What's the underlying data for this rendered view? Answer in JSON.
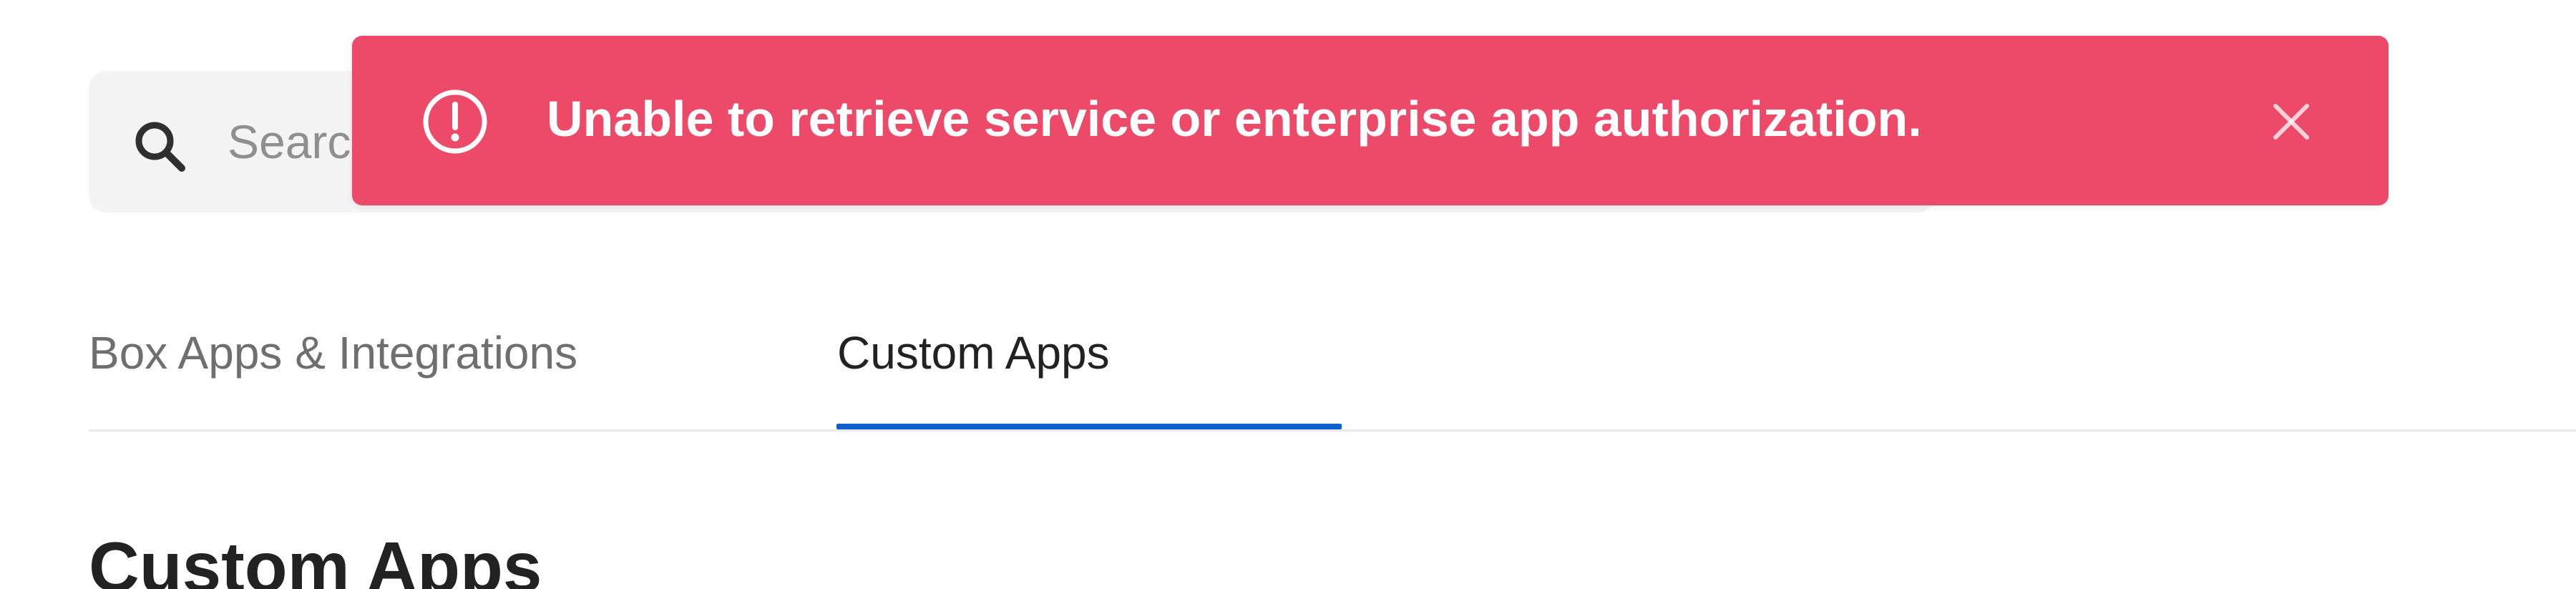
{
  "search": {
    "placeholder": "Search Users",
    "icon": "search-icon"
  },
  "toast": {
    "message": "Unable to retrieve service or enterprise app authorization.",
    "type": "error",
    "background_color": "#ed4a69",
    "icon": "alert-circle-icon",
    "close_icon": "close-icon"
  },
  "tabs": [
    {
      "label": "Box Apps & Integrations",
      "active": false
    },
    {
      "label": "Custom Apps",
      "active": true
    }
  ],
  "colors": {
    "accent": "#0f5fd1",
    "error": "#ed4a69",
    "text": "#222222",
    "muted_text": "#6f6f6f"
  },
  "main": {
    "title": "Custom Apps"
  }
}
